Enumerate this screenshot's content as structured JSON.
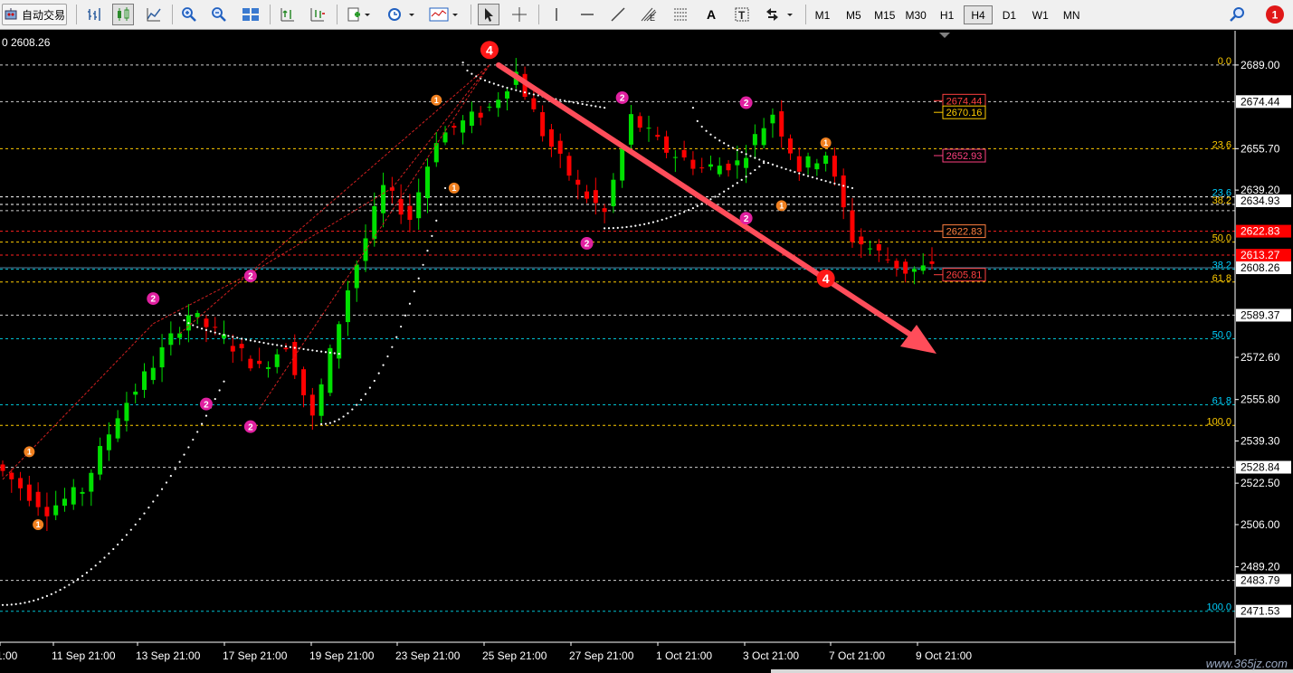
{
  "toolbar": {
    "autotrade_label": "自动交易",
    "timeframes": [
      "M1",
      "M5",
      "M15",
      "M30",
      "H1",
      "H4",
      "D1",
      "W1",
      "MN"
    ],
    "active_timeframe": "H4",
    "notification_count": "1",
    "tools": [
      "bar-chart-icon",
      "candlestick-icon",
      "line-chart-icon",
      "zoom-in-icon",
      "zoom-out-icon",
      "tile-windows-icon",
      "autoscroll-icon",
      "chart-shift-icon",
      "new-order-icon",
      "period-clock-icon",
      "templates-icon",
      "cursor-icon",
      "crosshair-icon",
      "vertical-line-icon",
      "horizontal-line-icon",
      "trendline-icon",
      "fibonacci-icon",
      "fib-retracement-icon",
      "text-icon",
      "text-label-icon",
      "arrows-icon",
      "search-icon"
    ]
  },
  "chart": {
    "price_readout": "0 2608.26",
    "y_min": 2466.0,
    "y_max": 2694.0,
    "y_axis_labels": [
      "2689.00",
      "2655.70",
      "2639.20",
      "2572.60",
      "2555.80",
      "2539.30",
      "2522.50",
      "2506.00",
      "2489.20"
    ],
    "y_axis_boxed": [
      {
        "text": "2674.44",
        "value": 2674.44,
        "bg": "#ffffff",
        "fg": "#000000"
      },
      {
        "text": "2634.93",
        "value": 2634.93,
        "bg": "#ffffff",
        "fg": "#000000"
      },
      {
        "text": "2622.83",
        "value": 2622.83,
        "bg": "#ff0000",
        "fg": "#ffffff"
      },
      {
        "text": "2613.27",
        "value": 2613.27,
        "bg": "#ff0000",
        "fg": "#ffffff"
      },
      {
        "text": "2608.26",
        "value": 2608.26,
        "bg": "#ffffff",
        "fg": "#000000"
      },
      {
        "text": "2589.37",
        "value": 2589.37,
        "bg": "#ffffff",
        "fg": "#000000"
      },
      {
        "text": "2528.84",
        "value": 2528.84,
        "bg": "#ffffff",
        "fg": "#000000"
      },
      {
        "text": "2483.79",
        "value": 2483.79,
        "bg": "#ffffff",
        "fg": "#000000"
      },
      {
        "text": "2471.53",
        "value": 2471.53,
        "bg": "#ffffff",
        "fg": "#000000"
      }
    ],
    "x_axis_labels": [
      "1:00",
      "11 Sep 21:00",
      "13 Sep 21:00",
      "17 Sep 21:00",
      "19 Sep 21:00",
      "23 Sep 21:00",
      "25 Sep 21:00",
      "27 Sep 21:00",
      "1 Oct 21:00",
      "3 Oct 21:00",
      "7 Oct 21:00",
      "9 Oct 21:00"
    ],
    "fib_labels": [
      {
        "text": "0.0",
        "value": 2689.0,
        "color": "#ffcc00"
      },
      {
        "text": "23.6",
        "value": 2655.7,
        "color": "#ffcc00"
      },
      {
        "text": "23.6",
        "value": 2636.5,
        "color": "#00d0ff"
      },
      {
        "text": "38.2",
        "value": 2633.5,
        "color": "#ffcc00"
      },
      {
        "text": "50.0",
        "value": 2618.5,
        "color": "#ffcc00"
      },
      {
        "text": "38.2",
        "value": 2607.7,
        "color": "#00d0ff"
      },
      {
        "text": "61.8",
        "value": 2602.6,
        "color": "#ffcc00"
      },
      {
        "text": "50.0",
        "value": 2580.0,
        "color": "#00d0ff"
      },
      {
        "text": "61.8",
        "value": 2553.7,
        "color": "#00d0ff"
      },
      {
        "text": "100.0",
        "value": 2545.5,
        "color": "#ffcc00"
      },
      {
        "text": "100.0",
        "value": 2471.5,
        "color": "#00d0ff"
      }
    ],
    "level_boxes": [
      {
        "text": "2674.44",
        "value": 2674.8,
        "color": "#ff4040"
      },
      {
        "text": "2670.16",
        "value": 2670.16,
        "color": "#ffcc00"
      },
      {
        "text": "2652.93",
        "value": 2652.93,
        "color": "#ff4080"
      },
      {
        "text": "2622.83",
        "value": 2622.83,
        "color": "#ff8040"
      },
      {
        "text": "2605.81",
        "value": 2605.5,
        "color": "#ff4040"
      }
    ],
    "wave_labels": [
      {
        "text": "4",
        "type": "big"
      },
      {
        "text": "1",
        "type": "orange"
      },
      {
        "text": "2",
        "type": "magenta"
      }
    ],
    "colors": {
      "bull": "#00e000",
      "bear": "#ff0000",
      "grid_white": "#d0d0d0",
      "grid_cyan": "#00c0d0",
      "grid_yellow": "#ffcc00",
      "arrow": "#ff4d5a"
    }
  },
  "watermark": "www.365jz.com"
}
